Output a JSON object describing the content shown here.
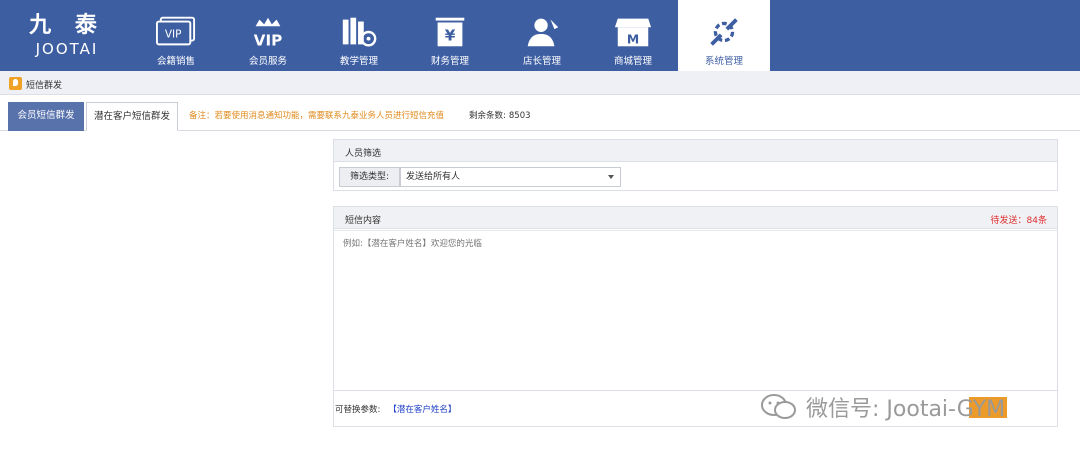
{
  "logo": {
    "cn": "九 泰",
    "en": "JOOTAI"
  },
  "nav": [
    {
      "label": "会籍销售",
      "icon": "vip-card-icon"
    },
    {
      "label": "会员服务",
      "icon": "vip-crown-icon"
    },
    {
      "label": "教学管理",
      "icon": "books-icon"
    },
    {
      "label": "财务管理",
      "icon": "finance-icon"
    },
    {
      "label": "店长管理",
      "icon": "manager-icon"
    },
    {
      "label": "商城管理",
      "icon": "store-icon"
    },
    {
      "label": "系统管理",
      "icon": "wrench-gear-icon"
    }
  ],
  "breadcrumb": {
    "label": "短信群发"
  },
  "tabs": [
    {
      "label": "会员短信群发"
    },
    {
      "label": "潜在客户短信群发"
    }
  ],
  "note": "备注：若要使用消息通知功能，需要联系九泰业务人员进行短信充值",
  "remaining": {
    "label": "剩余条数:",
    "value": "8503"
  },
  "filter_panel": {
    "title": "人员筛选",
    "type_label": "筛选类型:",
    "type_value": "发送给所有人"
  },
  "sms_panel": {
    "title": "短信内容",
    "pending": "待发送：84条",
    "placeholder": "例如:【潜在客户姓名】欢迎您的光临",
    "params_label": "可替换参数:",
    "param_tag": "【潜在客户姓名】"
  },
  "watermark": "微信号: Jootai-GYM",
  "colors": {
    "nav_bg": "#3e5ea2",
    "tab_active_bg": "#5872ac",
    "note": "#e08a1c",
    "pending": "#e03030",
    "param": "#1e3ec8"
  }
}
